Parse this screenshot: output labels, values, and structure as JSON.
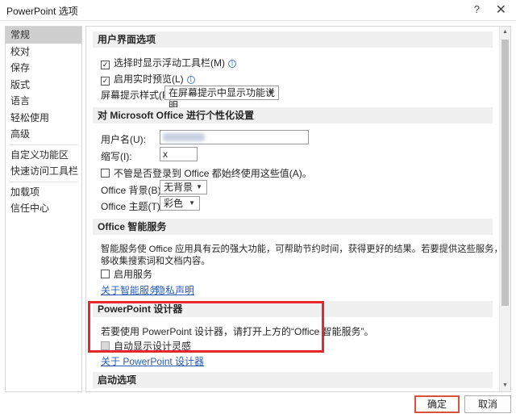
{
  "window": {
    "title": "PowerPoint 选项",
    "help_glyph": "?",
    "close_glyph": "✕"
  },
  "sidebar": {
    "items": [
      {
        "label": "常规",
        "active": true
      },
      {
        "label": "校对"
      },
      {
        "label": "保存"
      },
      {
        "label": "版式"
      },
      {
        "label": "语言"
      },
      {
        "label": "轻松使用"
      },
      {
        "label": "高级"
      },
      {
        "label": "自定义功能区"
      },
      {
        "label": "快速访问工具栏"
      },
      {
        "label": "加载项"
      },
      {
        "label": "信任中心"
      }
    ]
  },
  "ui_options": {
    "header": "用户界面选项",
    "mini_toolbar_label": "选择时显示浮动工具栏(M)",
    "mini_toolbar_checked": true,
    "live_preview_label": "启用实时预览(L)",
    "live_preview_checked": true,
    "screentip_label": "屏幕提示样式(R):",
    "screentip_value": "在屏幕提示中显示功能说明"
  },
  "personalize": {
    "header": "对 Microsoft Office 进行个性化设置",
    "username_label": "用户名(U):",
    "initials_label": "缩写(I):",
    "initials_value": "x",
    "always_use_label": "不管是否登录到 Office 都始终使用这些值(A)。",
    "always_use_checked": false,
    "background_label": "Office 背景(B):",
    "background_value": "无背景",
    "theme_label": "Office 主题(T):",
    "theme_value": "彩色"
  },
  "intelligent": {
    "header": "Office 智能服务",
    "description_line1": "智能服务使 Office 应用具有云的强大功能，可帮助节约时间，获得更好的结果。若要提供这些服务，Microsoft 需要能",
    "description_line2": "够收集搜索词和文档内容。",
    "enable_label": "启用服务",
    "enable_checked": false,
    "about_link": "关于智能服务",
    "privacy_link": "隐私声明"
  },
  "designer": {
    "header": "PowerPoint 设计器",
    "description": "若要使用 PowerPoint 设计器，请打开上方的“Office 智能服务”。",
    "auto_show_label": "自动显示设计灵感",
    "auto_show_checked": false,
    "about_link": "关于 PowerPoint 设计器"
  },
  "startup": {
    "header": "启动选项"
  },
  "footer": {
    "ok_label": "确定",
    "cancel_label": "取消"
  },
  "colors": {
    "highlight_border": "#e8262b",
    "ok_border": "#d9533b",
    "link": "#2a5bb5",
    "sidebar_active": "#cfcfcf",
    "section_header_bg": "#f0f0f0"
  }
}
